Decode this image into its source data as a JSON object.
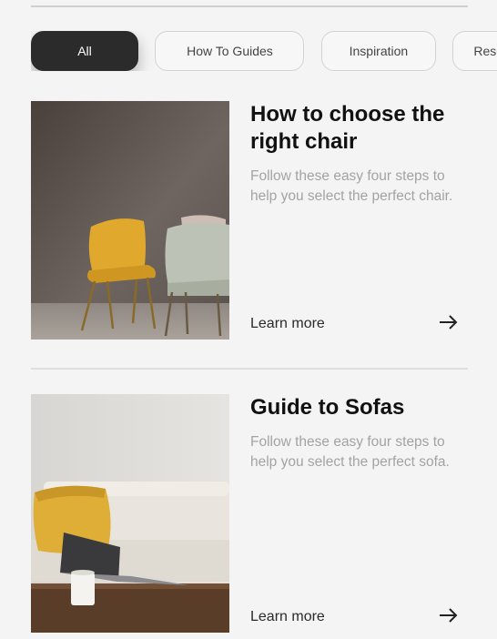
{
  "filters": {
    "chips": [
      {
        "label": "All",
        "active": true
      },
      {
        "label": "How To Guides",
        "active": false
      },
      {
        "label": "Inspiration",
        "active": false
      },
      {
        "label": "Resources",
        "active": false
      }
    ]
  },
  "articles": [
    {
      "title": "How to choose the right chair",
      "description": "Follow these easy four steps to help you select the perfect chair.",
      "link_label": "Learn more",
      "image_icon": "chairs-photo"
    },
    {
      "title": "Guide to Sofas",
      "description": "Follow these easy four steps to help you select the perfect sofa.",
      "link_label": "Learn more",
      "image_icon": "sofa-photo"
    }
  ],
  "colors": {
    "background": "#f4f4f4",
    "active_chip": "#2b2b2b",
    "muted_text": "#a3a3a3"
  }
}
